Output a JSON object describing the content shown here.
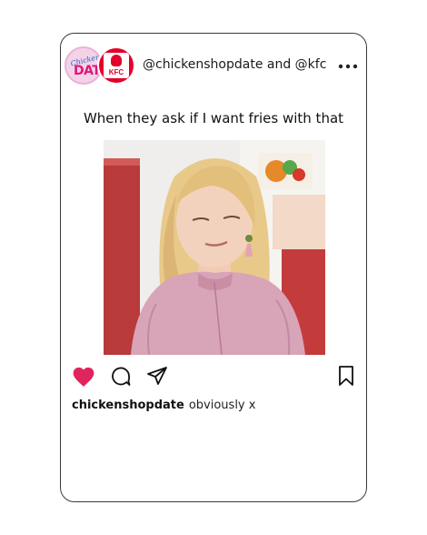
{
  "post": {
    "handle": "@chickenshopdate and @kfc",
    "meme_text": "When they ask if I want fries with that",
    "caption_user": "chickenshopdate",
    "caption_text": "obviously x",
    "liked": true
  },
  "avatars": {
    "chickenshop": {
      "script": "Chicken Shop",
      "word": "DATE"
    },
    "kfc": {
      "word": "KFC"
    }
  },
  "icons": [
    "heart-icon",
    "comment-icon",
    "share-icon",
    "bookmark-icon",
    "more-icon"
  ],
  "colors": {
    "like": "#e0245e",
    "kfc_red": "#e4002b",
    "chickenshop_pink": "#e0147a"
  }
}
